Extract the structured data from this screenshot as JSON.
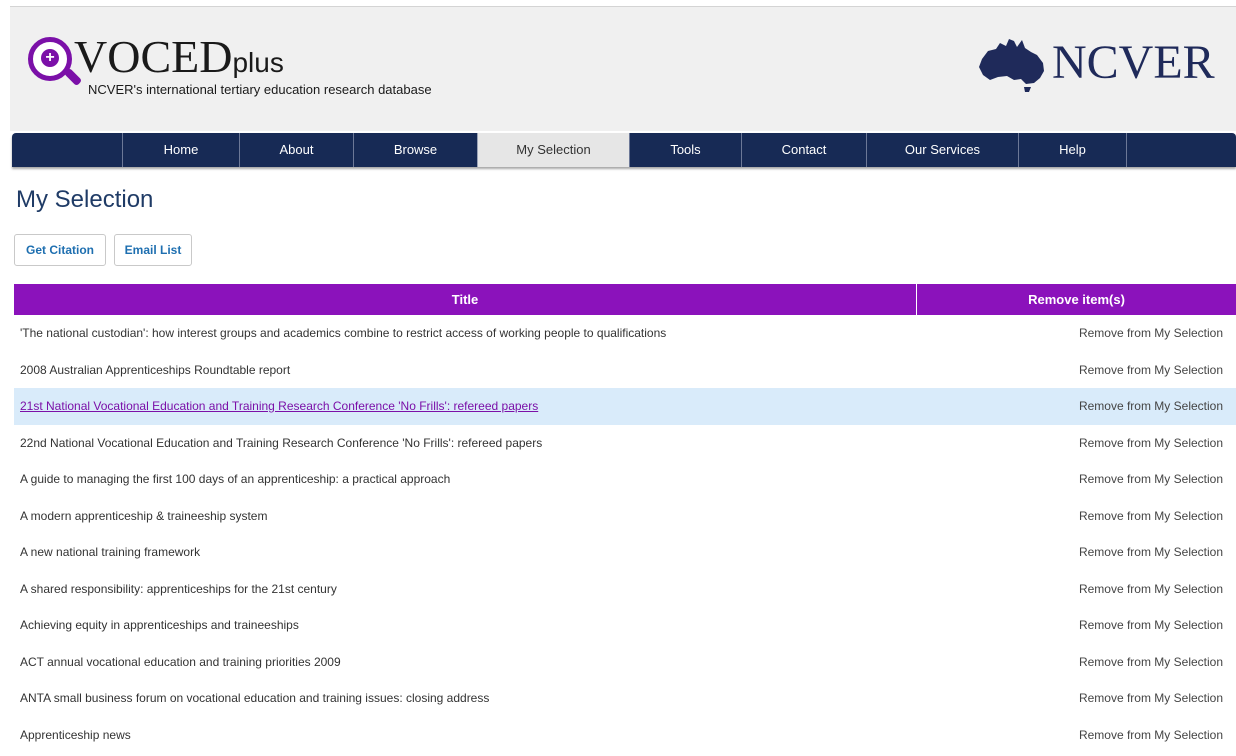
{
  "header": {
    "brand_main": "VOCED",
    "brand_suffix": "plus",
    "lens_plus": "+",
    "tagline": "NCVER's international tertiary education research database",
    "partner": "NCVER"
  },
  "colors": {
    "accent": "#8b12bb",
    "nav_background": "#172a55",
    "title": "#1f3b66",
    "link": "#1e6fb0",
    "row_highlight": "#d9ebfa"
  },
  "nav": {
    "items": [
      {
        "label": ""
      },
      {
        "label": "Home"
      },
      {
        "label": "About"
      },
      {
        "label": "Browse"
      },
      {
        "label": "My Selection",
        "active": true
      },
      {
        "label": "Tools"
      },
      {
        "label": "Contact"
      },
      {
        "label": "Our Services"
      },
      {
        "label": "Help"
      }
    ]
  },
  "page": {
    "title": "My Selection"
  },
  "actions": {
    "get_citation": "Get Citation",
    "email_list": "Email List"
  },
  "table": {
    "headers": {
      "title": "Title",
      "remove": "Remove item(s)"
    },
    "rows": [
      {
        "title": "'The national custodian': how interest groups and academics combine to restrict access of working people to qualifications",
        "remove": "Remove from My Selection"
      },
      {
        "title": "2008 Australian Apprenticeships Roundtable report",
        "remove": "Remove from My Selection"
      },
      {
        "title": "21st National Vocational Education and Training Research Conference 'No Frills': refereed papers",
        "remove": "Remove from My Selection",
        "highlighted": true
      },
      {
        "title": "22nd National Vocational Education and Training Research Conference 'No Frills': refereed papers",
        "remove": "Remove from My Selection"
      },
      {
        "title": "A guide to managing the first 100 days of an apprenticeship: a practical approach",
        "remove": "Remove from My Selection"
      },
      {
        "title": "A modern apprenticeship & traineeship system",
        "remove": "Remove from My Selection"
      },
      {
        "title": "A new national training framework",
        "remove": "Remove from My Selection"
      },
      {
        "title": "A shared responsibility: apprenticeships for the 21st century",
        "remove": "Remove from My Selection"
      },
      {
        "title": "Achieving equity in apprenticeships and traineeships",
        "remove": "Remove from My Selection"
      },
      {
        "title": "ACT annual vocational education and training priorities 2009",
        "remove": "Remove from My Selection"
      },
      {
        "title": "ANTA small business forum on vocational education and training issues: closing address",
        "remove": "Remove from My Selection"
      },
      {
        "title": "Apprenticeship news",
        "remove": "Remove from My Selection"
      }
    ]
  }
}
